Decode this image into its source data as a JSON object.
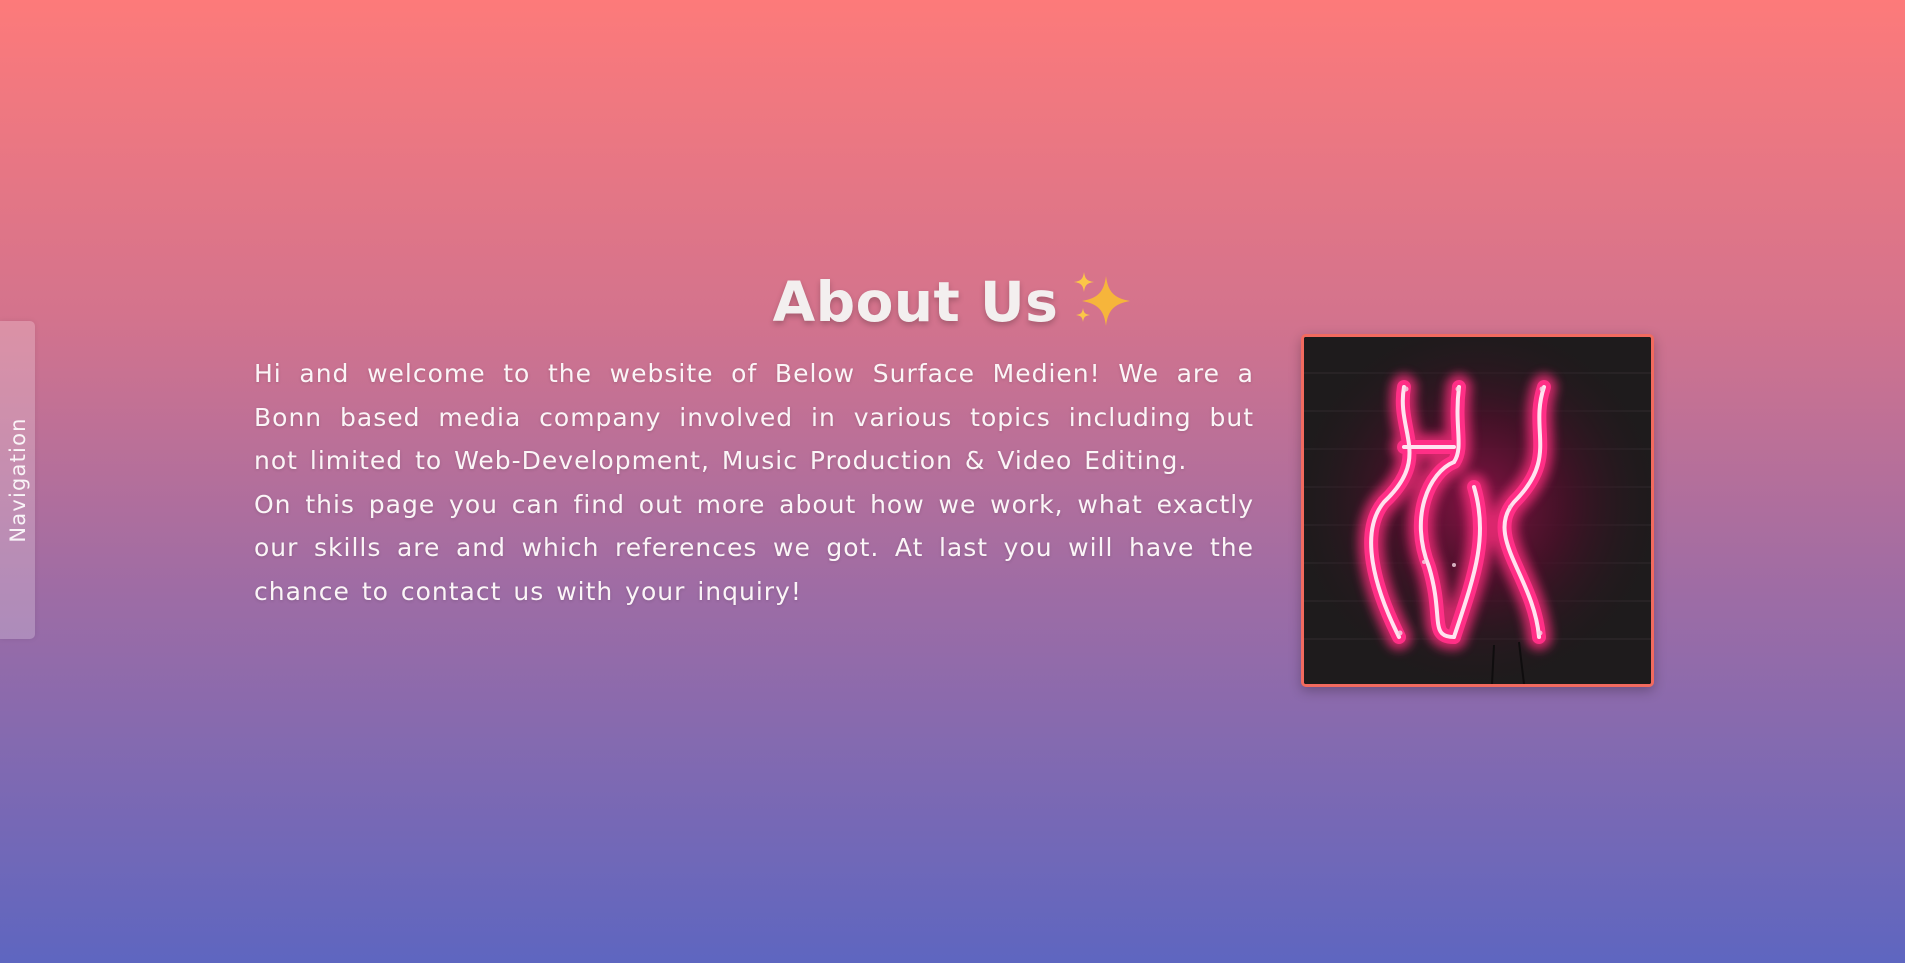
{
  "nav": {
    "label": "Navigation"
  },
  "about": {
    "title": "About Us",
    "title_icon": "sparkles-icon",
    "paragraphs": [
      "Hi and welcome to the website of Below Surface Medien! We are a Bonn based media company involved in various topics including but not limited to Web-Development, Music Production & Video Editing.",
      "On this page you can find out more about how we work, what exactly our skills are and which references we got. At last you will have the chance to contact us with your inquiry!"
    ]
  },
  "image": {
    "subject": "neon-hi-sign",
    "neon_color": "#ff2d7f",
    "frame_color": "#f26a5f"
  },
  "colors": {
    "gradient_top": "#fd7a7a",
    "gradient_bottom": "#5e66c0",
    "sparkle": "#f6b53b"
  }
}
